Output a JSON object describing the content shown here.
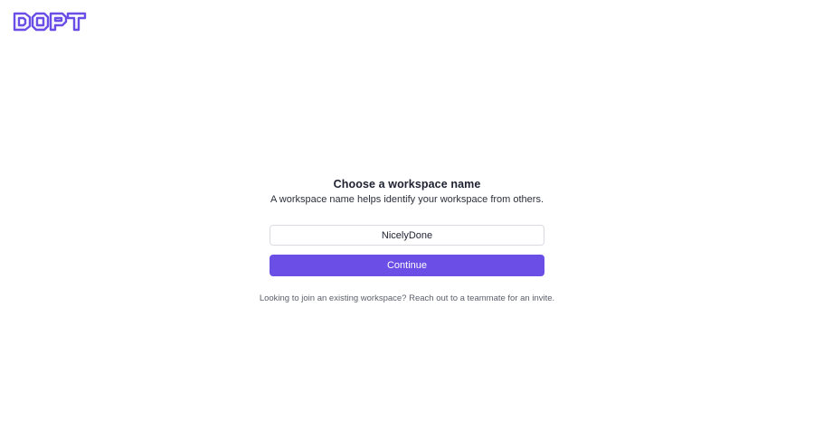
{
  "brand": {
    "logo_text": "DOPT",
    "accent_color": "#6b4ee6"
  },
  "form": {
    "title": "Choose a workspace name",
    "subtitle": "A workspace name helps identify your workspace from others.",
    "workspace_name_value": "NicelyDone",
    "continue_label": "Continue",
    "footer_note": "Looking to join an existing workspace? Reach out to a teammate for an invite."
  }
}
